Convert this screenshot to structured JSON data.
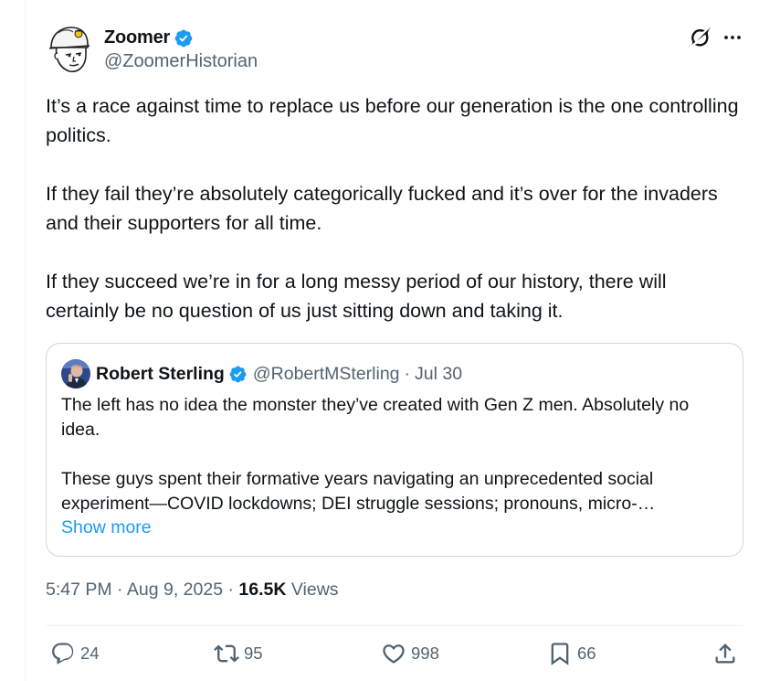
{
  "author": {
    "display_name": "Zoomer",
    "handle": "@ZoomerHistorian",
    "verified": true,
    "avatar_icon": "cartoon-avatar-icon"
  },
  "header_icons": {
    "grok": "grok-icon",
    "more": "more-icon"
  },
  "tweet": {
    "paragraphs": [
      "It’s a race against time to replace us before our generation is the one controlling politics.",
      "If they fail they’re absolutely categorically fucked and it’s over for the invaders and their supporters for all time.",
      "If they succeed we’re in for a long messy period of our history, there will certainly be no question of us just sitting down and taking it."
    ]
  },
  "quote": {
    "display_name": "Robert Sterling",
    "handle": "@RobertMSterling",
    "separator": "·",
    "date": "Jul 30",
    "verified": true,
    "paragraphs": [
      "The left has no idea the monster they’ve created with Gen Z men. Absolutely no idea.",
      "These guys spent their formative years navigating an unprecedented social experiment—COVID lockdowns; DEI struggle sessions; pronouns, micro-…"
    ],
    "show_more": "Show more"
  },
  "meta": {
    "time": "5:47 PM",
    "sep1": "·",
    "date": "Aug 9, 2025",
    "sep2": "·",
    "views_count": "16.5K",
    "views_label": "Views"
  },
  "actions": {
    "reply_count": "24",
    "retweet_count": "95",
    "like_count": "998",
    "bookmark_count": "66"
  },
  "colors": {
    "text": "#0f1419",
    "secondary": "#536471",
    "accent": "#1d9bf0",
    "border": "#cfd9de",
    "divider": "#eff3f4"
  }
}
